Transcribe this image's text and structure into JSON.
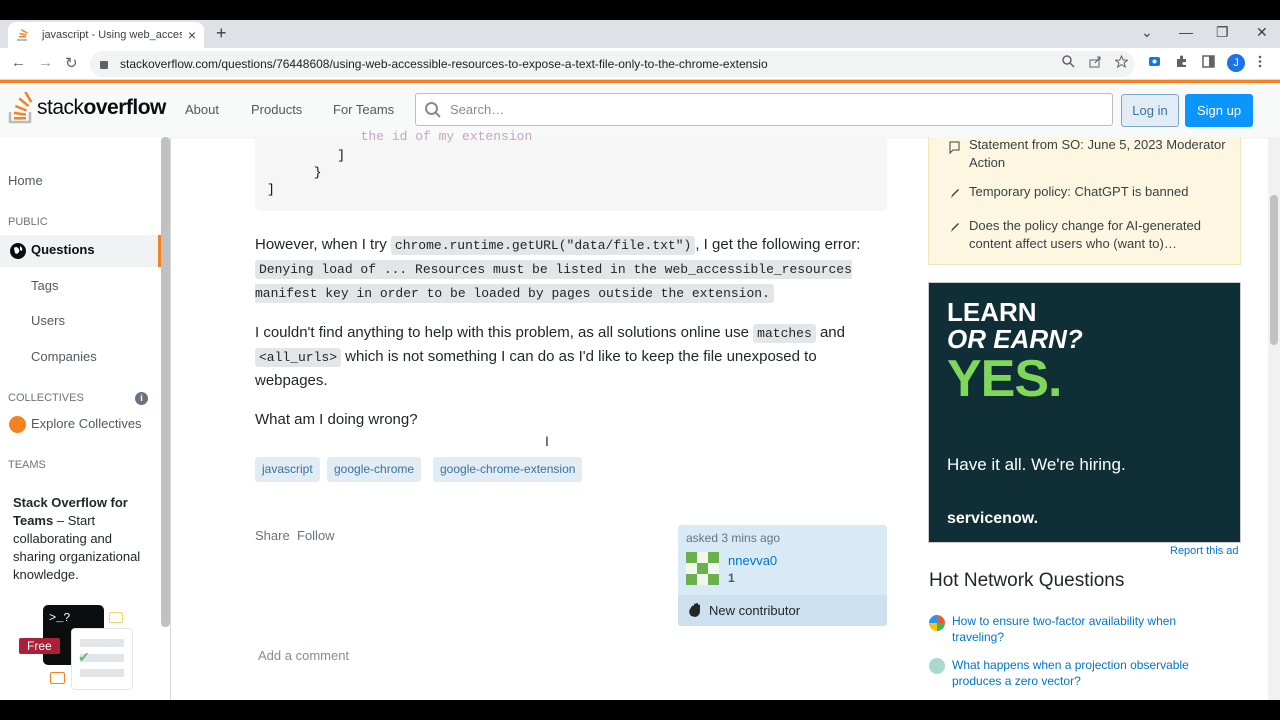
{
  "browser": {
    "tab_title": "javascript - Using web_accessible_",
    "tab_close": "×",
    "new_tab": "+",
    "url": "stackoverflow.com/questions/76448608/using-web-accessible-resources-to-expose-a-text-file-only-to-the-chrome-extensio",
    "profile_initial": "J",
    "window_controls": [
      "⌄",
      "—",
      "❐",
      "✕"
    ],
    "nav": {
      "back": "←",
      "forward": "→",
      "reload": "↻"
    }
  },
  "header": {
    "logo_light": "stack",
    "logo_bold": "overflow",
    "nav": [
      "About",
      "Products",
      "For Teams"
    ],
    "search_placeholder": "Search…",
    "login": "Log in",
    "signup": "Sign up"
  },
  "leftnav": {
    "home": "Home",
    "public_heading": "PUBLIC",
    "questions": "Questions",
    "tags": "Tags",
    "users": "Users",
    "companies": "Companies",
    "collectives_heading": "COLLECTIVES",
    "explore_collectives": "Explore Collectives",
    "teams_heading": "TEAMS",
    "teams_promo_bold": "Stack Overflow for Teams",
    "teams_promo_rest": " – Start collaborating and sharing organizational knowledge.",
    "free_badge": "Free",
    "terminal_prompt": ">_?"
  },
  "post": {
    "code_lines": [
      "            the id of my extension",
      "         ]",
      "      }",
      "]"
    ],
    "p1_a": "However, when I try ",
    "p1_code": "chrome.runtime.getURL(\"data/file.txt\")",
    "p1_b": ", I get the following error: ",
    "p1_error": "Denying load of ... Resources must be listed in the web_accessible_resources manifest key in order to be loaded by pages outside the extension.",
    "p2_a": "I couldn't find anything to help with this problem, as all solutions online use ",
    "p2_code1": "matches",
    "p2_b": " and ",
    "p2_code2": "<all_urls>",
    "p2_c": " which is not something I can do as I'd like to keep the file unexposed to webpages.",
    "p3": "What am I doing wrong?",
    "tags": [
      "javascript",
      "google-chrome",
      "google-chrome-extension"
    ],
    "share": "Share",
    "follow": "Follow",
    "asked": "asked 3 mins ago",
    "username": "nnevva0",
    "reputation": "1",
    "new_contributor": "New contributor",
    "add_comment": "Add a comment"
  },
  "sidebar": {
    "meta": [
      "Statement from SO: June 5, 2023 Moderator Action",
      "Temporary policy: ChatGPT is banned",
      "Does the policy change for AI-generated content affect users who (want to)…"
    ],
    "ad_line1": "LEARN",
    "ad_line2": "OR EARN?",
    "ad_yes": "YES.",
    "ad_hire": "Have it all. We're hiring.",
    "ad_brand": "servicenow.",
    "report_ad": "Report this ad",
    "hnq_title": "Hot Network Questions",
    "hnq": [
      "How to ensure two-factor availability when traveling?",
      "What happens when a projection observable produces a zero vector?"
    ]
  },
  "colors": {
    "accent": "#f48225",
    "link": "#0074cc",
    "primary_button": "#0a95ff",
    "tag_bg": "#e1ecf4",
    "meta_bg": "#fdf7e2",
    "ad_bg": "#0f2e35",
    "ad_yes": "#81d65c"
  }
}
